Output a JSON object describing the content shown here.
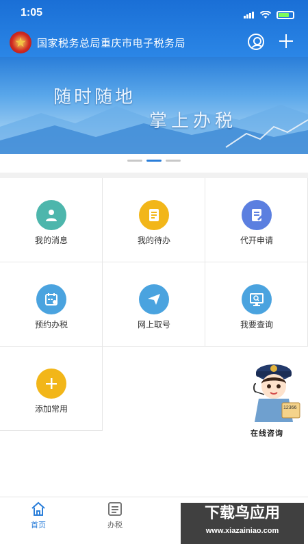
{
  "status_bar": {
    "time": "1:05"
  },
  "header": {
    "title": "国家税务总局重庆市电子税务局"
  },
  "banner": {
    "line1": "随时随地",
    "line2": "掌上办税"
  },
  "grid": {
    "items": [
      {
        "label": "我的消息",
        "icon": "user-message-icon",
        "color": "#4db6ac"
      },
      {
        "label": "我的待办",
        "icon": "todo-doc-icon",
        "color": "#f2b619"
      },
      {
        "label": "代开申请",
        "icon": "apply-doc-icon",
        "color": "#5b7fe0"
      },
      {
        "label": "预约办税",
        "icon": "calendar-icon",
        "color": "#4aa3df"
      },
      {
        "label": "网上取号",
        "icon": "paper-plane-icon",
        "color": "#4aa3df"
      },
      {
        "label": "我要查询",
        "icon": "monitor-search-icon",
        "color": "#4aa3df"
      },
      {
        "label": "添加常用",
        "icon": "plus-icon",
        "color": "#f2b619"
      }
    ]
  },
  "agent": {
    "label": "在线咨询",
    "badge": "12366"
  },
  "tabbar": {
    "tabs": [
      {
        "label": "首页",
        "icon": "home-icon",
        "active": true
      },
      {
        "label": "办税",
        "icon": "list-icon",
        "active": false
      }
    ]
  },
  "watermark": {
    "line1": "下载鸟应用",
    "line2": "www.xiazainiao.com"
  }
}
